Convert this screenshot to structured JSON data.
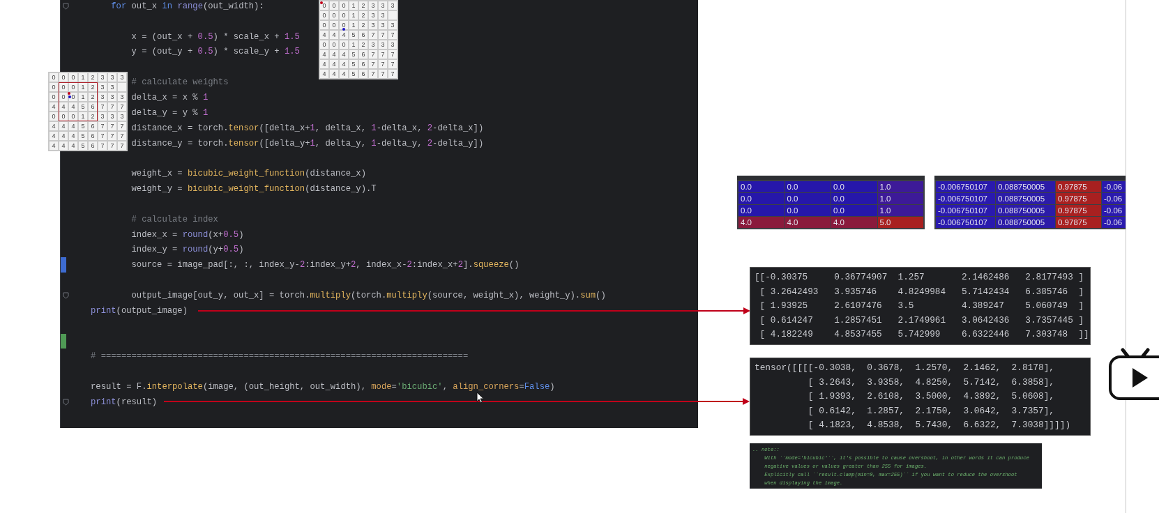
{
  "editor": {
    "lines": [
      {
        "kind": "code",
        "fold": true,
        "tokens": [
          {
            "text": "    for",
            "kind": "kw"
          },
          {
            "text": " out_x ",
            "kind": "plain"
          },
          {
            "text": "in ",
            "kind": "kw"
          },
          {
            "text": "range",
            "kind": "builtin"
          },
          {
            "text": "(out_width):",
            "kind": "plain"
          }
        ]
      },
      {
        "kind": "blank"
      },
      {
        "kind": "code",
        "tokens": [
          {
            "text": "        x = (out_x + ",
            "kind": "plain"
          },
          {
            "text": "0.5",
            "kind": "num"
          },
          {
            "text": ") * scale_x + ",
            "kind": "plain"
          },
          {
            "text": "1.5",
            "kind": "num"
          }
        ]
      },
      {
        "kind": "code",
        "tokens": [
          {
            "text": "        y = (out_y + ",
            "kind": "plain"
          },
          {
            "text": "0.5",
            "kind": "num"
          },
          {
            "text": ") * scale_y + ",
            "kind": "plain"
          },
          {
            "text": "1.5",
            "kind": "num"
          }
        ]
      },
      {
        "kind": "blank"
      },
      {
        "kind": "code",
        "tokens": [
          {
            "text": "        # calculate weights",
            "kind": "comment"
          }
        ]
      },
      {
        "kind": "code",
        "tokens": [
          {
            "text": "        delta_x = x % ",
            "kind": "plain"
          },
          {
            "text": "1",
            "kind": "num"
          }
        ]
      },
      {
        "kind": "code",
        "tokens": [
          {
            "text": "        delta_y = y % ",
            "kind": "plain"
          },
          {
            "text": "1",
            "kind": "num"
          }
        ]
      },
      {
        "kind": "code",
        "tokens": [
          {
            "text": "        distance_x = torch.",
            "kind": "plain"
          },
          {
            "text": "tensor",
            "kind": "fn"
          },
          {
            "text": "([delta_x+",
            "kind": "plain"
          },
          {
            "text": "1",
            "kind": "num"
          },
          {
            "text": ", delta_x, ",
            "kind": "plain"
          },
          {
            "text": "1",
            "kind": "num"
          },
          {
            "text": "-delta_x, ",
            "kind": "plain"
          },
          {
            "text": "2",
            "kind": "num"
          },
          {
            "text": "-delta_x])",
            "kind": "plain"
          }
        ]
      },
      {
        "kind": "code",
        "tokens": [
          {
            "text": "        distance_y = torch.",
            "kind": "plain"
          },
          {
            "text": "tensor",
            "kind": "fn"
          },
          {
            "text": "([delta_y+",
            "kind": "plain"
          },
          {
            "text": "1",
            "kind": "num"
          },
          {
            "text": ", delta_y, ",
            "kind": "plain"
          },
          {
            "text": "1",
            "kind": "num"
          },
          {
            "text": "-delta_y, ",
            "kind": "plain"
          },
          {
            "text": "2",
            "kind": "num"
          },
          {
            "text": "-delta_y])",
            "kind": "plain"
          }
        ]
      },
      {
        "kind": "blank"
      },
      {
        "kind": "code",
        "tokens": [
          {
            "text": "        weight_x = ",
            "kind": "plain"
          },
          {
            "text": "bicubic_weight_function",
            "kind": "fn"
          },
          {
            "text": "(distance_x)",
            "kind": "plain"
          }
        ]
      },
      {
        "kind": "code",
        "tokens": [
          {
            "text": "        weight_y = ",
            "kind": "plain"
          },
          {
            "text": "bicubic_weight_function",
            "kind": "fn"
          },
          {
            "text": "(distance_y).T",
            "kind": "plain"
          }
        ]
      },
      {
        "kind": "blank"
      },
      {
        "kind": "code",
        "tokens": [
          {
            "text": "        # calculate index",
            "kind": "comment"
          }
        ]
      },
      {
        "kind": "code",
        "tokens": [
          {
            "text": "        index_x = ",
            "kind": "plain"
          },
          {
            "text": "round",
            "kind": "builtin"
          },
          {
            "text": "(x+",
            "kind": "plain"
          },
          {
            "text": "0.5",
            "kind": "num"
          },
          {
            "text": ")",
            "kind": "plain"
          }
        ]
      },
      {
        "kind": "code",
        "tokens": [
          {
            "text": "        index_y = ",
            "kind": "plain"
          },
          {
            "text": "round",
            "kind": "builtin"
          },
          {
            "text": "(y+",
            "kind": "plain"
          },
          {
            "text": "0.5",
            "kind": "num"
          },
          {
            "text": ")",
            "kind": "plain"
          }
        ]
      },
      {
        "kind": "code",
        "modified": true,
        "tokens": [
          {
            "text": "        source = image_pad[:, :, index_y-",
            "kind": "plain"
          },
          {
            "text": "2",
            "kind": "num"
          },
          {
            "text": ":index_y+",
            "kind": "plain"
          },
          {
            "text": "2",
            "kind": "num"
          },
          {
            "text": ", index_x-",
            "kind": "plain"
          },
          {
            "text": "2",
            "kind": "num"
          },
          {
            "text": ":index_x+",
            "kind": "plain"
          },
          {
            "text": "2",
            "kind": "num"
          },
          {
            "text": "].",
            "kind": "plain"
          },
          {
            "text": "squeeze",
            "kind": "fn"
          },
          {
            "text": "()",
            "kind": "plain"
          }
        ]
      },
      {
        "kind": "blank"
      },
      {
        "kind": "code",
        "fold": true,
        "tokens": [
          {
            "text": "        output_image[out_y, out_x] = torch.",
            "kind": "plain"
          },
          {
            "text": "multiply",
            "kind": "fn"
          },
          {
            "text": "(torch.",
            "kind": "plain"
          },
          {
            "text": "multiply",
            "kind": "fn"
          },
          {
            "text": "(source, weight_x), weight_y).",
            "kind": "plain"
          },
          {
            "text": "sum",
            "kind": "fn"
          },
          {
            "text": "()",
            "kind": "plain"
          }
        ]
      },
      {
        "kind": "code",
        "tokens": [
          {
            "text": "print",
            "kind": "builtin"
          },
          {
            "text": "(output_image)",
            "kind": "plain"
          }
        ]
      },
      {
        "kind": "blank"
      },
      {
        "kind": "blank",
        "added": true
      },
      {
        "kind": "code",
        "tokens": [
          {
            "text": "# ========================================================================",
            "kind": "comment"
          }
        ]
      },
      {
        "kind": "blank"
      },
      {
        "kind": "code",
        "tokens": [
          {
            "text": "result = F.",
            "kind": "plain"
          },
          {
            "text": "interpolate",
            "kind": "fn"
          },
          {
            "text": "(image, (out_height, out_width), ",
            "kind": "plain"
          },
          {
            "text": "mode",
            "kind": "param"
          },
          {
            "text": "=",
            "kind": "plain"
          },
          {
            "text": "'bicubic'",
            "kind": "str"
          },
          {
            "text": ", ",
            "kind": "plain"
          },
          {
            "text": "align_corners",
            "kind": "param"
          },
          {
            "text": "=",
            "kind": "plain"
          },
          {
            "text": "False",
            "kind": "kw"
          },
          {
            "text": ")",
            "kind": "plain"
          }
        ]
      },
      {
        "kind": "code",
        "fold": true,
        "tokens": [
          {
            "text": "print",
            "kind": "builtin"
          },
          {
            "text": "(result)",
            "kind": "plain"
          }
        ]
      }
    ]
  },
  "grids": [
    {
      "framed": false,
      "rows": [
        [
          "0",
          "0",
          "0",
          "1",
          "2",
          "3",
          "3",
          "3"
        ],
        [
          "0",
          "0",
          "0",
          "1",
          "2",
          "3",
          "3"
        ],
        [
          "0",
          "0",
          "0",
          "1",
          "2",
          "3",
          "3",
          "3"
        ],
        [
          "4",
          "4",
          "4",
          "5",
          "6",
          "7",
          "7",
          "7"
        ],
        [
          "0",
          "0",
          "0",
          "1",
          "2",
          "3",
          "3",
          "3"
        ],
        [
          "4",
          "4",
          "4",
          "5",
          "6",
          "7",
          "7",
          "7"
        ],
        [
          "4",
          "4",
          "4",
          "5",
          "6",
          "7",
          "7",
          "7"
        ],
        [
          "4",
          "4",
          "4",
          "5",
          "6",
          "7",
          "7",
          "7"
        ]
      ]
    },
    {
      "framed": true,
      "rows": [
        [
          "0",
          "0",
          "0",
          "1",
          "2",
          "3",
          "3",
          "3"
        ],
        [
          "0",
          "0",
          "0",
          "1",
          "2",
          "3",
          "3"
        ],
        [
          "0",
          "0",
          "0",
          "1",
          "2",
          "3",
          "3",
          "3"
        ],
        [
          "4",
          "4",
          "4",
          "5",
          "6",
          "7",
          "7",
          "7"
        ],
        [
          "0",
          "0",
          "0",
          "1",
          "2",
          "3",
          "3",
          "3"
        ],
        [
          "4",
          "4",
          "4",
          "5",
          "6",
          "7",
          "7",
          "7"
        ],
        [
          "4",
          "4",
          "4",
          "5",
          "6",
          "7",
          "7",
          "7"
        ],
        [
          "4",
          "4",
          "4",
          "5",
          "6",
          "7",
          "7",
          "7"
        ]
      ]
    }
  ],
  "tables": [
    {
      "rows": [
        [
          {
            "text": "0.0",
            "color": "#2617aa"
          },
          {
            "text": "0.0",
            "color": "#2617aa"
          },
          {
            "text": "0.0",
            "color": "#2617aa"
          },
          {
            "text": "1.0",
            "color": "#3d1a98"
          }
        ],
        [
          {
            "text": "0.0",
            "color": "#2617aa"
          },
          {
            "text": "0.0",
            "color": "#2617aa"
          },
          {
            "text": "0.0",
            "color": "#2617aa"
          },
          {
            "text": "1.0",
            "color": "#3d1a98"
          }
        ],
        [
          {
            "text": "0.0",
            "color": "#2617aa"
          },
          {
            "text": "0.0",
            "color": "#2617aa"
          },
          {
            "text": "0.0",
            "color": "#2617aa"
          },
          {
            "text": "1.0",
            "color": "#3d1a98"
          }
        ],
        [
          {
            "text": "4.0",
            "color": "#8a1a3c"
          },
          {
            "text": "4.0",
            "color": "#8a1a3c"
          },
          {
            "text": "4.0",
            "color": "#8a1a3c"
          },
          {
            "text": "5.0",
            "color": "#a82020"
          }
        ]
      ]
    },
    {
      "rows": [
        [
          {
            "text": "-0.006750107",
            "color": "#2a1aae"
          },
          {
            "text": "0.088750005",
            "color": "#2c1ca8"
          },
          {
            "text": "0.97875",
            "color": "#a82020"
          },
          {
            "text": "-0.06",
            "color": "#2a1aae"
          }
        ],
        [
          {
            "text": "-0.006750107",
            "color": "#2a1aae"
          },
          {
            "text": "0.088750005",
            "color": "#2c1ca8"
          },
          {
            "text": "0.97875",
            "color": "#a82020"
          },
          {
            "text": "-0.06",
            "color": "#2a1aae"
          }
        ],
        [
          {
            "text": "-0.006750107",
            "color": "#2a1aae"
          },
          {
            "text": "0.088750005",
            "color": "#2c1ca8"
          },
          {
            "text": "0.97875",
            "color": "#a82020"
          },
          {
            "text": "-0.06",
            "color": "#2a1aae"
          }
        ],
        [
          {
            "text": "-0.006750107",
            "color": "#2a1aae"
          },
          {
            "text": "0.088750005",
            "color": "#2c1ca8"
          },
          {
            "text": "0.97875",
            "color": "#a82020"
          },
          {
            "text": "-0.06",
            "color": "#2a1aae"
          }
        ]
      ]
    }
  ],
  "output_manual": [
    "[[-0.30375     0.36774907  1.257       2.1462486   2.8177493 ]",
    " [ 3.2642493   3.935746    4.8249984   5.7142434   6.385746  ]",
    " [ 1.93925     2.6107476   3.5         4.389247    5.060749  ]",
    " [ 0.614247    1.2857451   2.1749961   3.0642436   3.7357445 ]",
    " [ 4.182249    4.8537455   5.742999    6.6322446   7.303748  ]]"
  ],
  "output_torch": [
    "tensor([[[[-0.3038,  0.3678,  1.2570,  2.1462,  2.8178],",
    "          [ 3.2643,  3.9358,  4.8250,  5.7142,  6.3858],",
    "          [ 1.9393,  2.6108,  3.5000,  4.3892,  5.0608],",
    "          [ 0.6142,  1.2857,  2.1750,  3.0642,  3.7357],",
    "          [ 4.1823,  4.8538,  5.7430,  6.6322,  7.3038]]]])"
  ],
  "note": [
    ".. note::",
    "    With ``mode='bicubic'``, it's possible to cause overshoot, in other words it can produce",
    "    negative values or values greater than 255 for images.",
    "    Explicitly call ``result.clamp(min=0, max=255)`` if you want to reduce the overshoot",
    "    when displaying the image."
  ]
}
